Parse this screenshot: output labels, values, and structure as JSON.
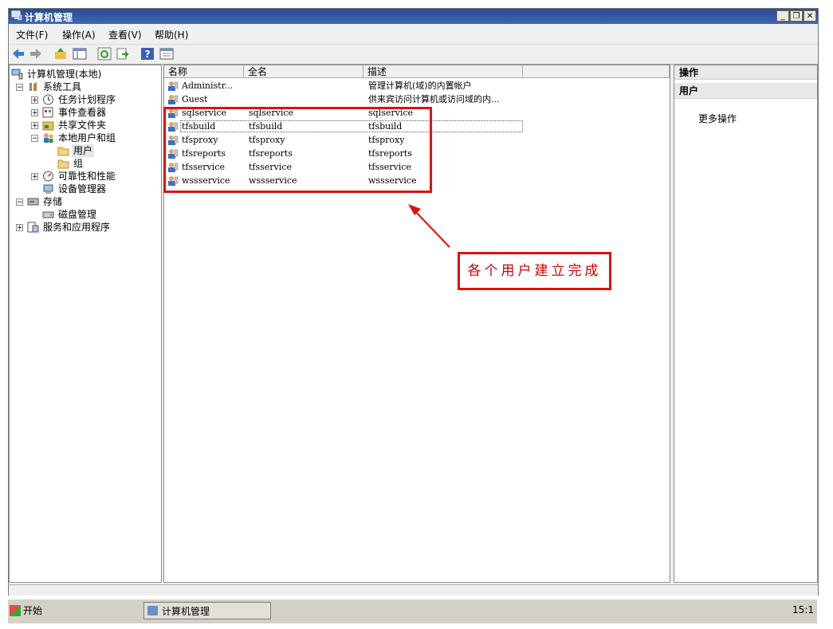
{
  "window": {
    "title": "计算机管理"
  },
  "menu": [
    "文件(F)",
    "操作(A)",
    "查看(V)",
    "帮助(H)"
  ],
  "toolbar_icons": [
    "back-arrow-icon",
    "forward-arrow-icon",
    "up-folder-icon",
    "show-hide-tree-icon",
    "refresh-icon",
    "export-list-icon",
    "help-icon",
    "properties-icon"
  ],
  "tree": [
    {
      "label": "计算机管理(本地)",
      "level": 0,
      "icon": "computer-management-icon",
      "expander": ""
    },
    {
      "label": "系统工具",
      "level": 1,
      "icon": "system-tools-icon",
      "expander": "−"
    },
    {
      "label": "任务计划程序",
      "level": 2,
      "icon": "clock-icon",
      "expander": "+"
    },
    {
      "label": "事件查看器",
      "level": 2,
      "icon": "event-viewer-icon",
      "expander": "+"
    },
    {
      "label": "共享文件夹",
      "level": 2,
      "icon": "shared-folder-icon",
      "expander": "+"
    },
    {
      "label": "本地用户和组",
      "level": 2,
      "icon": "users-groups-icon",
      "expander": "−"
    },
    {
      "label": "用户",
      "level": 3,
      "icon": "folder-icon",
      "expander": "",
      "selected": true
    },
    {
      "label": "组",
      "level": 3,
      "icon": "folder-icon",
      "expander": ""
    },
    {
      "label": "可靠性和性能",
      "level": 2,
      "icon": "performance-icon",
      "expander": "+"
    },
    {
      "label": "设备管理器",
      "level": 2,
      "icon": "device-manager-icon",
      "expander": ""
    },
    {
      "label": "存储",
      "level": 1,
      "icon": "storage-icon",
      "expander": "−"
    },
    {
      "label": "磁盘管理",
      "level": 2,
      "icon": "disk-icon",
      "expander": ""
    },
    {
      "label": "服务和应用程序",
      "level": 1,
      "icon": "services-icon",
      "expander": "+"
    }
  ],
  "list": {
    "columns": [
      "名称",
      "全名",
      "描述"
    ],
    "rows": [
      {
        "name": "Administr...",
        "fullname": "",
        "desc": "管理计算机(域)的内置帐户"
      },
      {
        "name": "Guest",
        "fullname": "",
        "desc": "供来宾访问计算机或访问域的内..."
      },
      {
        "name": "sqlservice",
        "fullname": "sqlservice",
        "desc": "sqlservice"
      },
      {
        "name": "tfsbuild",
        "fullname": "tfsbuild",
        "desc": "tfsbuild"
      },
      {
        "name": "tfsproxy",
        "fullname": "tfsproxy",
        "desc": "tfsproxy"
      },
      {
        "name": "tfsreports",
        "fullname": "tfsreports",
        "desc": "tfsreports"
      },
      {
        "name": "tfsservice",
        "fullname": "tfsservice",
        "desc": "tfsservice"
      },
      {
        "name": "wssservice",
        "fullname": "wssservice",
        "desc": "wssservice"
      }
    ]
  },
  "actions": {
    "header": "操作",
    "section": "用户",
    "item": "更多操作"
  },
  "annotation": {
    "text": "各个用户建立完成",
    "color": "#e01010"
  },
  "taskbar": {
    "start": "开始",
    "task": "计算机管理",
    "clock": "15:1"
  },
  "colors": {
    "titlebar": "#2d4a8e",
    "accent_red": "#e01010"
  }
}
